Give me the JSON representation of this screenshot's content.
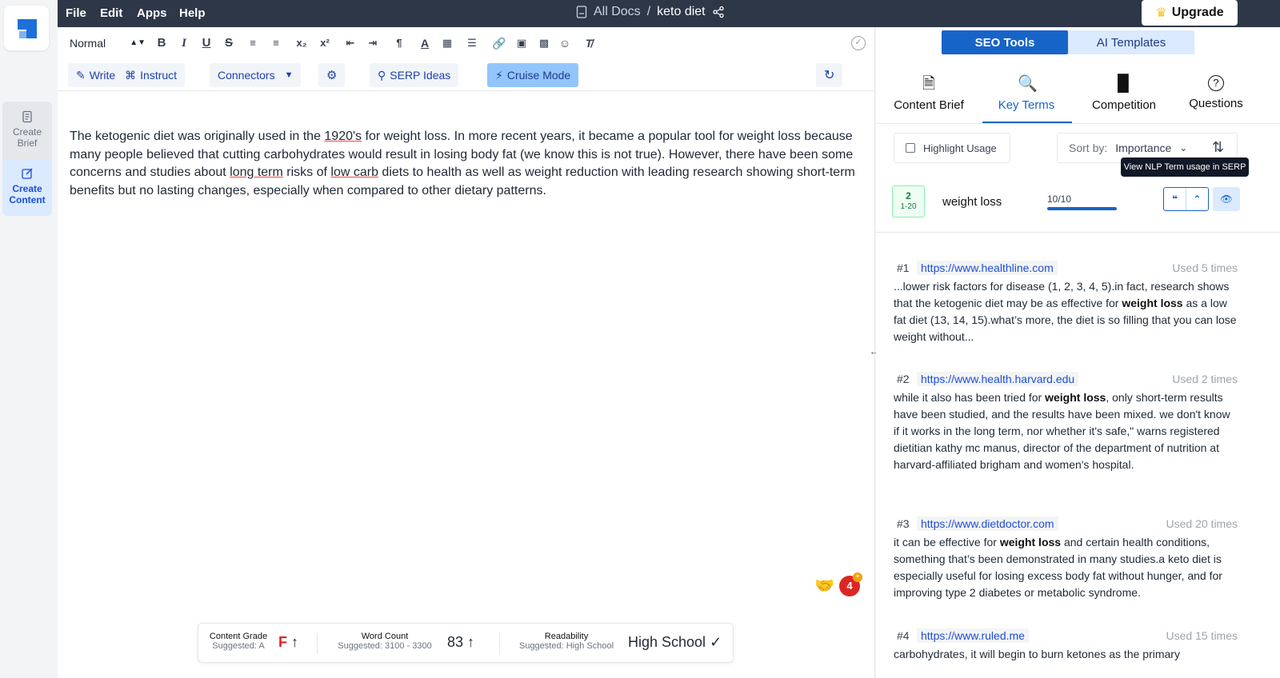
{
  "rail": {
    "create_brief": "Create Brief",
    "create_content": "Create Content"
  },
  "menu": {
    "file": "File",
    "edit": "Edit",
    "apps": "Apps",
    "help": "Help"
  },
  "breadcrumb": {
    "root": "All Docs",
    "separator": "/",
    "doc": "keto diet"
  },
  "upgrade": "Upgrade",
  "toolbar": {
    "format": "Normal",
    "write": "Write",
    "instruct": "Instruct",
    "connectors": "Connectors",
    "serp_ideas": "SERP Ideas",
    "cruise_mode": "Cruise Mode"
  },
  "document": {
    "p1": "The ketogenic diet was originally used in the ",
    "w1": "1920's",
    "p2": " for weight loss. In more recent years, it became a popular tool for weight loss because many people believed that cutting carbohydrates would result in losing body fat (we know this is not true). However, there have been some concerns and studies about ",
    "w2": "long term",
    "p3": " risks of ",
    "w3": "low carb",
    "p4": " diets to health as well as weight reduction with leading research showing short-term benefits but no lasting changes, especially when compared to other dietary patterns."
  },
  "notifications": "4",
  "status": {
    "grade_label": "Content Grade",
    "grade_suggested": "Suggested: A",
    "grade_value": "F",
    "words_label": "Word Count",
    "words_suggested": "Suggested: 3100 - 3300",
    "words_value": "83",
    "read_label": "Readability",
    "read_suggested": "Suggested: High School",
    "read_value": "High School"
  },
  "panel": {
    "seo_tools": "SEO Tools",
    "ai_templates": "AI Templates",
    "tabs": [
      "Content Brief",
      "Key Terms",
      "Competition",
      "Questions"
    ],
    "highlight_usage": "Highlight Usage",
    "sort_by": "Sort by:",
    "sort_value": "Importance",
    "tooltip": "View NLP Term usage in SERP",
    "term": {
      "rank": "2",
      "range": "1-20",
      "name": "weight loss",
      "count": "10/10"
    },
    "results": [
      {
        "num": "#1",
        "url": "https://www.healthline.com",
        "used": "Used 5 times",
        "pre": "...lower risk factors for disease (1, 2, 3, 4, 5).in fact, research shows that the ketogenic diet may be as effective for ",
        "bold": "weight loss",
        "post": " as a low fat diet (13, 14, 15).what’s more, the diet is so filling that you can lose weight without..."
      },
      {
        "num": "#2",
        "url": "https://www.health.harvard.edu",
        "used": "Used 2 times",
        "pre": "while it also has been tried for ",
        "bold": "weight loss",
        "post": ", only short-term results have been studied, and the results have been mixed. we don't know if it works in the long term, nor whether it's safe,\" warns registered dietitian kathy mc manus, director of the department of nutrition at harvard-affiliated brigham and women's hospital."
      },
      {
        "num": "#3",
        "url": "https://www.dietdoctor.com",
        "used": "Used 20 times",
        "pre": "it can be effective for ",
        "bold": "weight loss",
        "post": " and certain health conditions, something that’s been demonstrated in many studies.a keto diet is especially useful for losing excess body fat without hunger, and for improving type 2 diabetes or metabolic syndrome."
      },
      {
        "num": "#4",
        "url": "https://www.ruled.me",
        "used": "Used 15 times",
        "pre": "carbohydrates, it will begin to burn ketones as the primary",
        "bold": "",
        "post": ""
      }
    ]
  },
  "colors": {
    "accent": "#1764c8",
    "topbar": "#2d3748",
    "grade_fail": "#dc2626"
  }
}
